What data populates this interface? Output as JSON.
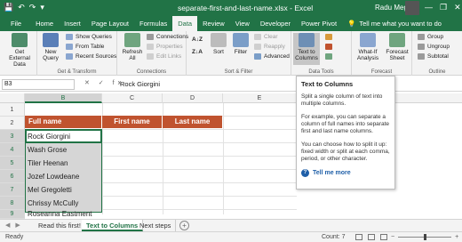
{
  "window": {
    "title": "separate-first-and-last-name.xlsx  -  Excel",
    "user": "Radu Meghes",
    "qat": [
      "💾",
      "↶",
      "↷",
      "▾"
    ],
    "controls": [
      "—",
      "❐",
      "✕"
    ]
  },
  "tabs": [
    "File",
    "Home",
    "Insert",
    "Page Layout",
    "Formulas",
    "Data",
    "Review",
    "View",
    "Developer",
    "Power Pivot"
  ],
  "active_tab": "Data",
  "tell_me": "Tell me what you want to do",
  "ribbon": {
    "get_external_data": "Get External Data",
    "new_query": "New Query",
    "show_queries": "Show Queries",
    "from_table": "From Table",
    "recent_sources": "Recent Sources",
    "group_get_transform": "Get & Transform",
    "refresh_all": "Refresh All",
    "connections": "Connections",
    "properties": "Properties",
    "edit_links": "Edit Links",
    "group_connections": "Connections",
    "sort": "Sort",
    "filter": "Filter",
    "clear": "Clear",
    "reapply": "Reapply",
    "advanced": "Advanced",
    "group_sort_filter": "Sort & Filter",
    "text_to_columns": "Text to Columns",
    "group_data_tools": "Data Tools",
    "what_if": "What-If Analysis",
    "forecast_sheet": "Forecast Sheet",
    "group_forecast": "Forecast",
    "group_btn": "Group",
    "ungroup": "Ungroup",
    "subtotal": "Subtotal",
    "group_outline": "Outline"
  },
  "formula_bar": {
    "name_box": "B3",
    "fx": "✕ ✓ fx",
    "value": "Rock Giorgini"
  },
  "columns": [
    "A",
    "B",
    "C",
    "D",
    "E"
  ],
  "rows": [
    "1",
    "2",
    "3",
    "4",
    "5",
    "6",
    "7",
    "8",
    "9"
  ],
  "table": {
    "headers": [
      "Full name",
      "First name",
      "Last name"
    ],
    "names": [
      "Rock Giorgini",
      "Wash Grose",
      "Tiler Heenan",
      "Jozef Lowdeane",
      "Mel Gregoletti",
      "Chrissy McCully",
      "Roseanna Eastment"
    ]
  },
  "tooltip": {
    "title": "Text to Columns",
    "p1": "Split a single column of text into multiple columns.",
    "p2": "For example, you can separate a column of full names into separate first and last name columns.",
    "p3": "You can choose how to split it up: fixed width or split at each comma, period, or other character.",
    "tell_me_more": "Tell me more"
  },
  "sheets": [
    "Read this first!",
    "Text to Columns",
    "Next steps"
  ],
  "active_sheet": "Text to Columns",
  "status": {
    "ready": "Ready",
    "count": "Count: 7"
  },
  "colors": {
    "excel_green": "#217346",
    "header_fill": "#c0532f"
  }
}
